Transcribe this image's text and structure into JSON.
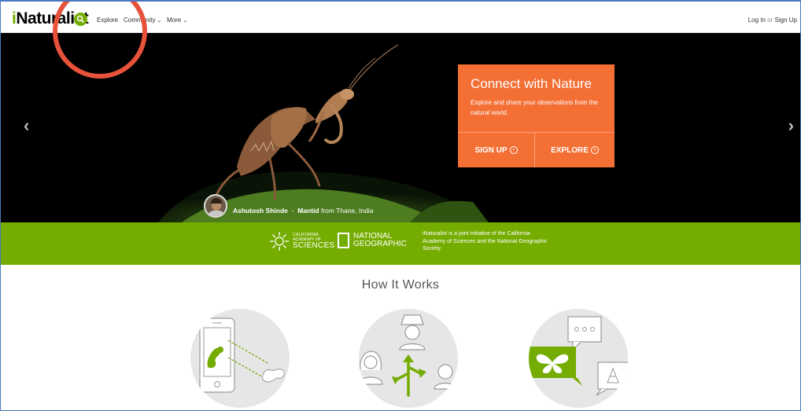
{
  "header": {
    "logo_prefix": "i",
    "logo_rest": "Naturalist",
    "nav": {
      "explore": "Explore",
      "community": "Community",
      "more": "More"
    },
    "login": "Log In",
    "login_or": "or",
    "signup": "Sign Up"
  },
  "hero": {
    "cta": {
      "title": "Connect with Nature",
      "description": "Explore and share your observations from the natural world.",
      "signup_label": "SIGN UP",
      "explore_label": "EXPLORE"
    },
    "credit": {
      "photographer": "Ashutosh Shinde",
      "separator": "-",
      "species": "Mantid",
      "location": "from Thane, India"
    }
  },
  "partners": {
    "cas_line1": "CALIFORNIA",
    "cas_line2": "ACADEMY OF",
    "cas_line3": "SCIENCES",
    "ng_line1": "NATIONAL",
    "ng_line2": "GEOGRAPHIC",
    "description": "iNaturalist is a joint initiative of the California Academy of Sciences and the National Geographic Society."
  },
  "how_it_works": {
    "title": "How It Works"
  },
  "colors": {
    "brand_green": "#74ac00",
    "cta_orange": "#f46f34",
    "annotation_red": "#e8523b"
  },
  "icons": [
    "search-icon",
    "chevron-down-icon",
    "arrow-left-icon",
    "arrow-right-icon",
    "circle-arrow-right-icon",
    "caterpillar-phone-icon",
    "people-share-icon",
    "butterfly-chat-icon"
  ]
}
